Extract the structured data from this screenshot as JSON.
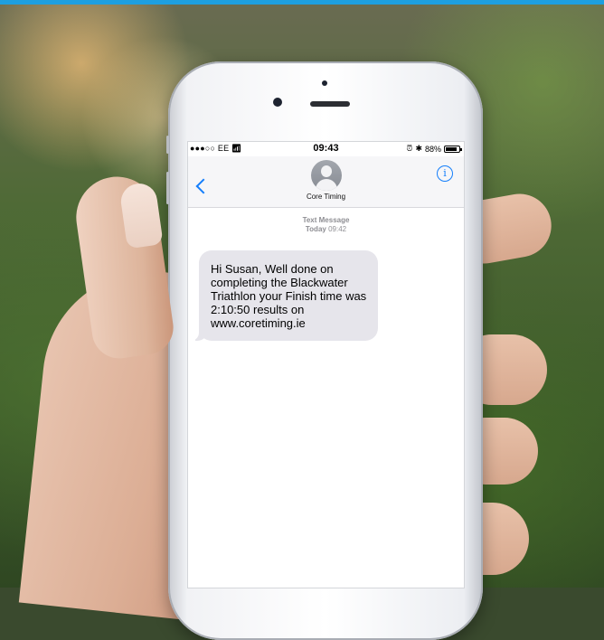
{
  "status_bar": {
    "carrier": "●●●○○ EE",
    "time": "09:43",
    "battery_percent": "88%",
    "battery_level": 0.88
  },
  "conversation": {
    "contact_name": "Core Timing",
    "message_kind": "Text Message",
    "day_label": "Today",
    "time_label": "09:42"
  },
  "messages": [
    {
      "direction": "incoming",
      "text": "Hi Susan, Well done on completing the Blackwater Triathlon your Finish time was 2:10:50 results on www.coretiming.ie"
    }
  ],
  "colors": {
    "ios_blue": "#147efb",
    "incoming_bubble": "#e6e5eb",
    "top_accent": "#1e9fe0"
  }
}
